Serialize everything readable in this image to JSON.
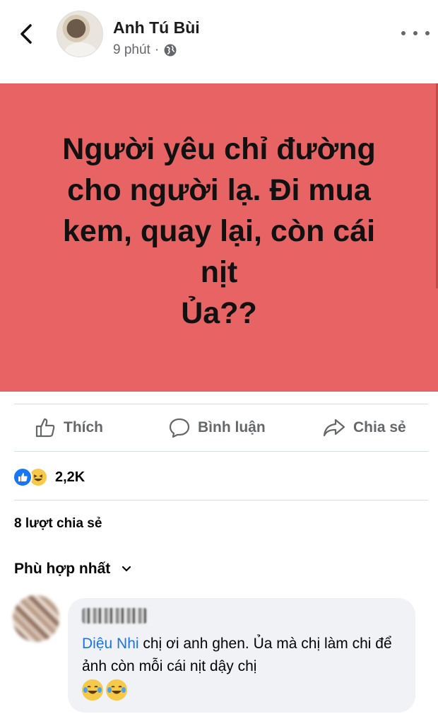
{
  "post": {
    "author": "Anh Tú Bùi",
    "time": "9 phút",
    "separator": "·",
    "privacy_icon": "globe-icon",
    "text_lines": [
      "Người yêu chỉ đường",
      "cho người lạ. Đi mua",
      "kem, quay lại, còn cái",
      "nịt",
      "Ủa??"
    ],
    "background_color": "#e86464"
  },
  "actions": {
    "like": "Thích",
    "comment": "Bình luận",
    "share": "Chia sẻ"
  },
  "stats": {
    "reaction_count": "2,2K",
    "reaction_icons": [
      "like-icon",
      "haha-icon"
    ],
    "shares": "8 lượt chia sẻ"
  },
  "comments_sort": "Phù hợp nhất",
  "comment": {
    "mention": "Diệu Nhi",
    "text": " chị ơi anh ghen. Ủa mà chị làm chi để ảnh còn mỗi cái nịt dậy chị",
    "emojis": [
      "laughing-tears-icon",
      "laughing-tears-icon"
    ]
  },
  "colors": {
    "accent": "#1877f2",
    "mention": "#1b74e4",
    "muted": "#65676b"
  }
}
